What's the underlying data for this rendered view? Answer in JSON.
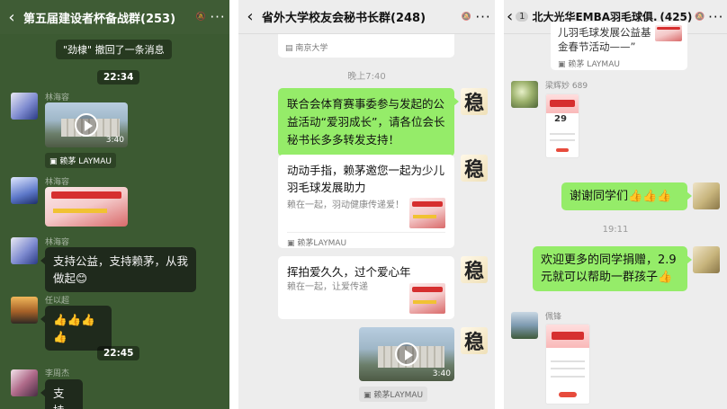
{
  "panel1": {
    "title": "第五届建设者杯备战群(253)",
    "recall_notice": "\"劲棣\" 撤回了一条消息",
    "time1": "22:34",
    "sender1": "林海容",
    "video1_duration": "3:40",
    "source_label": "赖茅 LAYMAU",
    "sender2": "林海容",
    "sender3": "林海容",
    "msg_support": "支持公益，支持赖茅，从我做起😊",
    "sender4": "任以超",
    "msg_thumbs": "👍👍👍👍",
    "time2": "22:45",
    "sender5": "李周杰",
    "msg_support2": "支持"
  },
  "panel2": {
    "title": "省外大学校友会秘书长群(248)",
    "top_card_source": "南京大学",
    "time1": "晚上7:40",
    "msg_forward": "联合会体育赛事委参与发起的公益活动“爱羽成长”，请各位会长秘书长多多转发支持！",
    "card1_title": "动动手指，赖茅邀您一起为少儿羽毛球发展助力",
    "card1_desc": "赖在一起，羽动健康传递爱！",
    "card1_source": "赖茅LAYMAU",
    "card2_title": "挥拍爱久久，过个爱心年",
    "card2_desc": "赖在一起，让爱传递",
    "video_duration": "3:40",
    "video_source": "赖茅LAYMAU",
    "avatar_char": "稳"
  },
  "panel3": {
    "badge": "1",
    "title": "北大光华EMBA羽毛球俱...",
    "count": "(425)",
    "top_card_text": "儿羽毛球发展公益基金春节活动——”",
    "top_card_source": "赖茅 LAYMAU",
    "sender1": "梁辉妙 689",
    "poster_amount": "29",
    "msg_thanks": "谢谢同学们👍👍👍",
    "time1": "19:11",
    "msg_welcome": "欢迎更多的同学捐赠，2.9元就可以帮助一群孩子👍",
    "sender2": "佩锋"
  }
}
